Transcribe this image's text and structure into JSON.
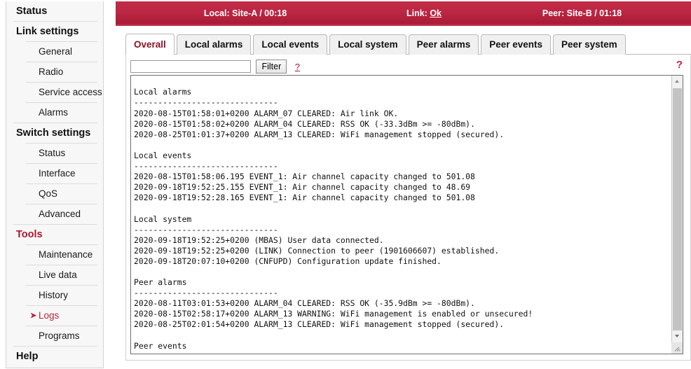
{
  "sidebar": {
    "groups": [
      {
        "label": "Status",
        "accent": false,
        "children": []
      },
      {
        "label": "Link settings",
        "accent": false,
        "children": [
          {
            "label": "General",
            "active": false
          },
          {
            "label": "Radio",
            "active": false
          },
          {
            "label": "Service access",
            "active": false
          },
          {
            "label": "Alarms",
            "active": false
          }
        ]
      },
      {
        "label": "Switch settings",
        "accent": false,
        "children": [
          {
            "label": "Status",
            "active": false
          },
          {
            "label": "Interface",
            "active": false
          },
          {
            "label": "QoS",
            "active": false
          },
          {
            "label": "Advanced",
            "active": false
          }
        ]
      },
      {
        "label": "Tools",
        "accent": true,
        "children": [
          {
            "label": "Maintenance",
            "active": false
          },
          {
            "label": "Live data",
            "active": false
          },
          {
            "label": "History",
            "active": false
          },
          {
            "label": "Logs",
            "active": true
          },
          {
            "label": "Programs",
            "active": false
          }
        ]
      },
      {
        "label": "Help",
        "accent": false,
        "children": []
      }
    ],
    "active_marker": "➤"
  },
  "status_bar": {
    "local_label": "Local:",
    "local_value": "Site-A / 00:18",
    "local_text": "Local: Site-A / 00:18",
    "link_label": "Link:",
    "link_state": "Ok",
    "peer_label": "Peer:",
    "peer_value": "Site-B / 01:18",
    "peer_text": "Peer: Site-B / 01:18",
    "background_color": "#bb2743"
  },
  "tabs": [
    {
      "label": "Overall",
      "active": true
    },
    {
      "label": "Local alarms",
      "active": false
    },
    {
      "label": "Local events",
      "active": false
    },
    {
      "label": "Local system",
      "active": false
    },
    {
      "label": "Peer alarms",
      "active": false
    },
    {
      "label": "Peer events",
      "active": false
    },
    {
      "label": "Peer system",
      "active": false
    }
  ],
  "filter": {
    "value": "",
    "placeholder": "",
    "button_label": "Filter",
    "help_label": "?",
    "page_help_label": "?"
  },
  "log": {
    "sections": [
      {
        "title": "Local alarms",
        "separator": "------------------------------",
        "lines": [
          "2020-08-15T01:58:01+0200 ALARM_07 CLEARED: Air link OK.",
          "2020-08-15T01:58:02+0200 ALARM_04 CLEARED: RSS OK (-33.3dBm >= -80dBm).",
          "2020-08-25T01:01:37+0200 ALARM_13 CLEARED: WiFi management stopped (secured)."
        ]
      },
      {
        "title": "Local events",
        "separator": "------------------------------",
        "lines": [
          "2020-08-15T01:58:06.195 EVENT_1: Air channel capacity changed to 501.08",
          "2020-09-18T19:52:25.155 EVENT_1: Air channel capacity changed to 48.69",
          "2020-09-18T19:52:28.165 EVENT_1: Air channel capacity changed to 501.08"
        ]
      },
      {
        "title": "Local system",
        "separator": "------------------------------",
        "lines": [
          "2020-09-18T19:52:25+0200 (MBAS) User data connected.",
          "2020-09-18T19:52:25+0200 (LINK) Connection to peer (1901606607) established.",
          "2020-09-18T20:07:10+0200 (CNFUPD) Configuration update finished."
        ]
      },
      {
        "title": "Peer alarms",
        "separator": "------------------------------",
        "lines": [
          "2020-08-11T03:01:53+0200 ALARM_04 CLEARED: RSS OK (-35.9dBm >= -80dBm).",
          "2020-08-15T02:58:17+0200 ALARM_13 WARNING: WiFi management is enabled or unsecured!",
          "2020-08-25T02:01:54+0200 ALARM_13 CLEARED: WiFi management stopped (secured)."
        ]
      },
      {
        "title": "Peer events",
        "separator": "------------------------------",
        "lines": []
      }
    ]
  },
  "icons": {
    "scroll_up": "scroll-up-arrow",
    "scroll_down": "scroll-down-arrow",
    "resize": "resize-grip"
  }
}
